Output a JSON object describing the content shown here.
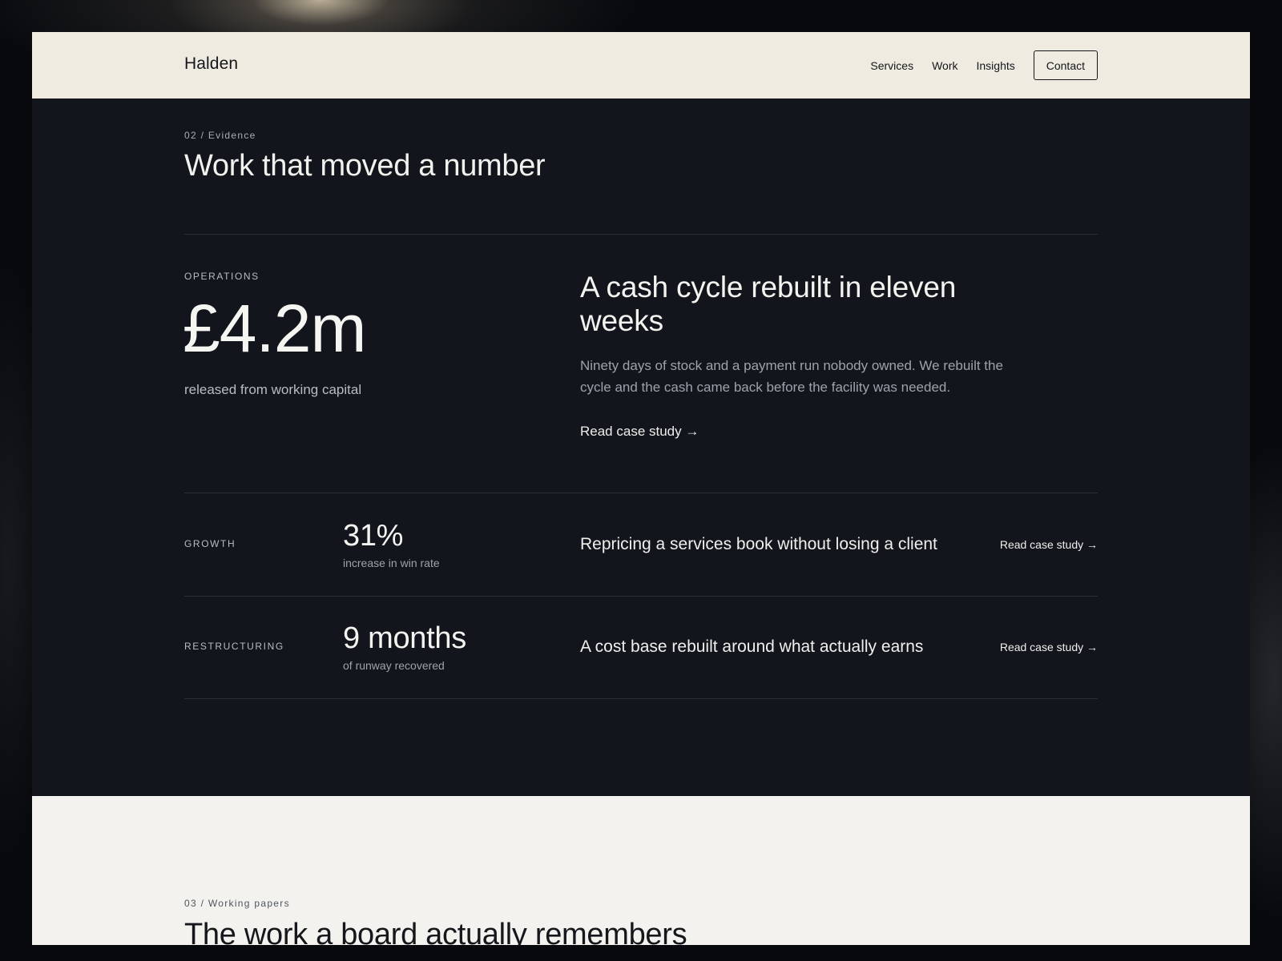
{
  "header": {
    "brand": "Halden",
    "nav": [
      "Services",
      "Work",
      "Insights"
    ],
    "contact_label": "Contact"
  },
  "evidence": {
    "eyebrow": "02 / Evidence",
    "title": "Work that moved a number",
    "featured": {
      "category": "Operations",
      "number": "£4.2m",
      "caption": "released from working capital",
      "title": "A cash cycle rebuilt in eleven weeks",
      "body": "Ninety days of stock and a payment run nobody owned. We rebuilt the cycle and the cash came back before the facility was needed.",
      "link": "Read case study →"
    },
    "rows": [
      {
        "category": "Growth",
        "number": "31%",
        "caption": "increase in win rate",
        "title": "Repricing a services book without losing a client",
        "link": "Read case study →"
      },
      {
        "category": "Restructuring",
        "number": "9 months",
        "caption": "of runway recovered",
        "title": "A cost base rebuilt around what actually earns",
        "link": "Read case study →"
      }
    ]
  },
  "papers": {
    "eyebrow": "03 / Working papers",
    "title": "The work a board actually remembers"
  },
  "colors": {
    "header_bg": "#efebe1",
    "dark_section_bg": "#12151c",
    "light_section_bg": "#f3f2ee",
    "text_light": "#f1f1ee",
    "text_dark": "#15171c"
  }
}
